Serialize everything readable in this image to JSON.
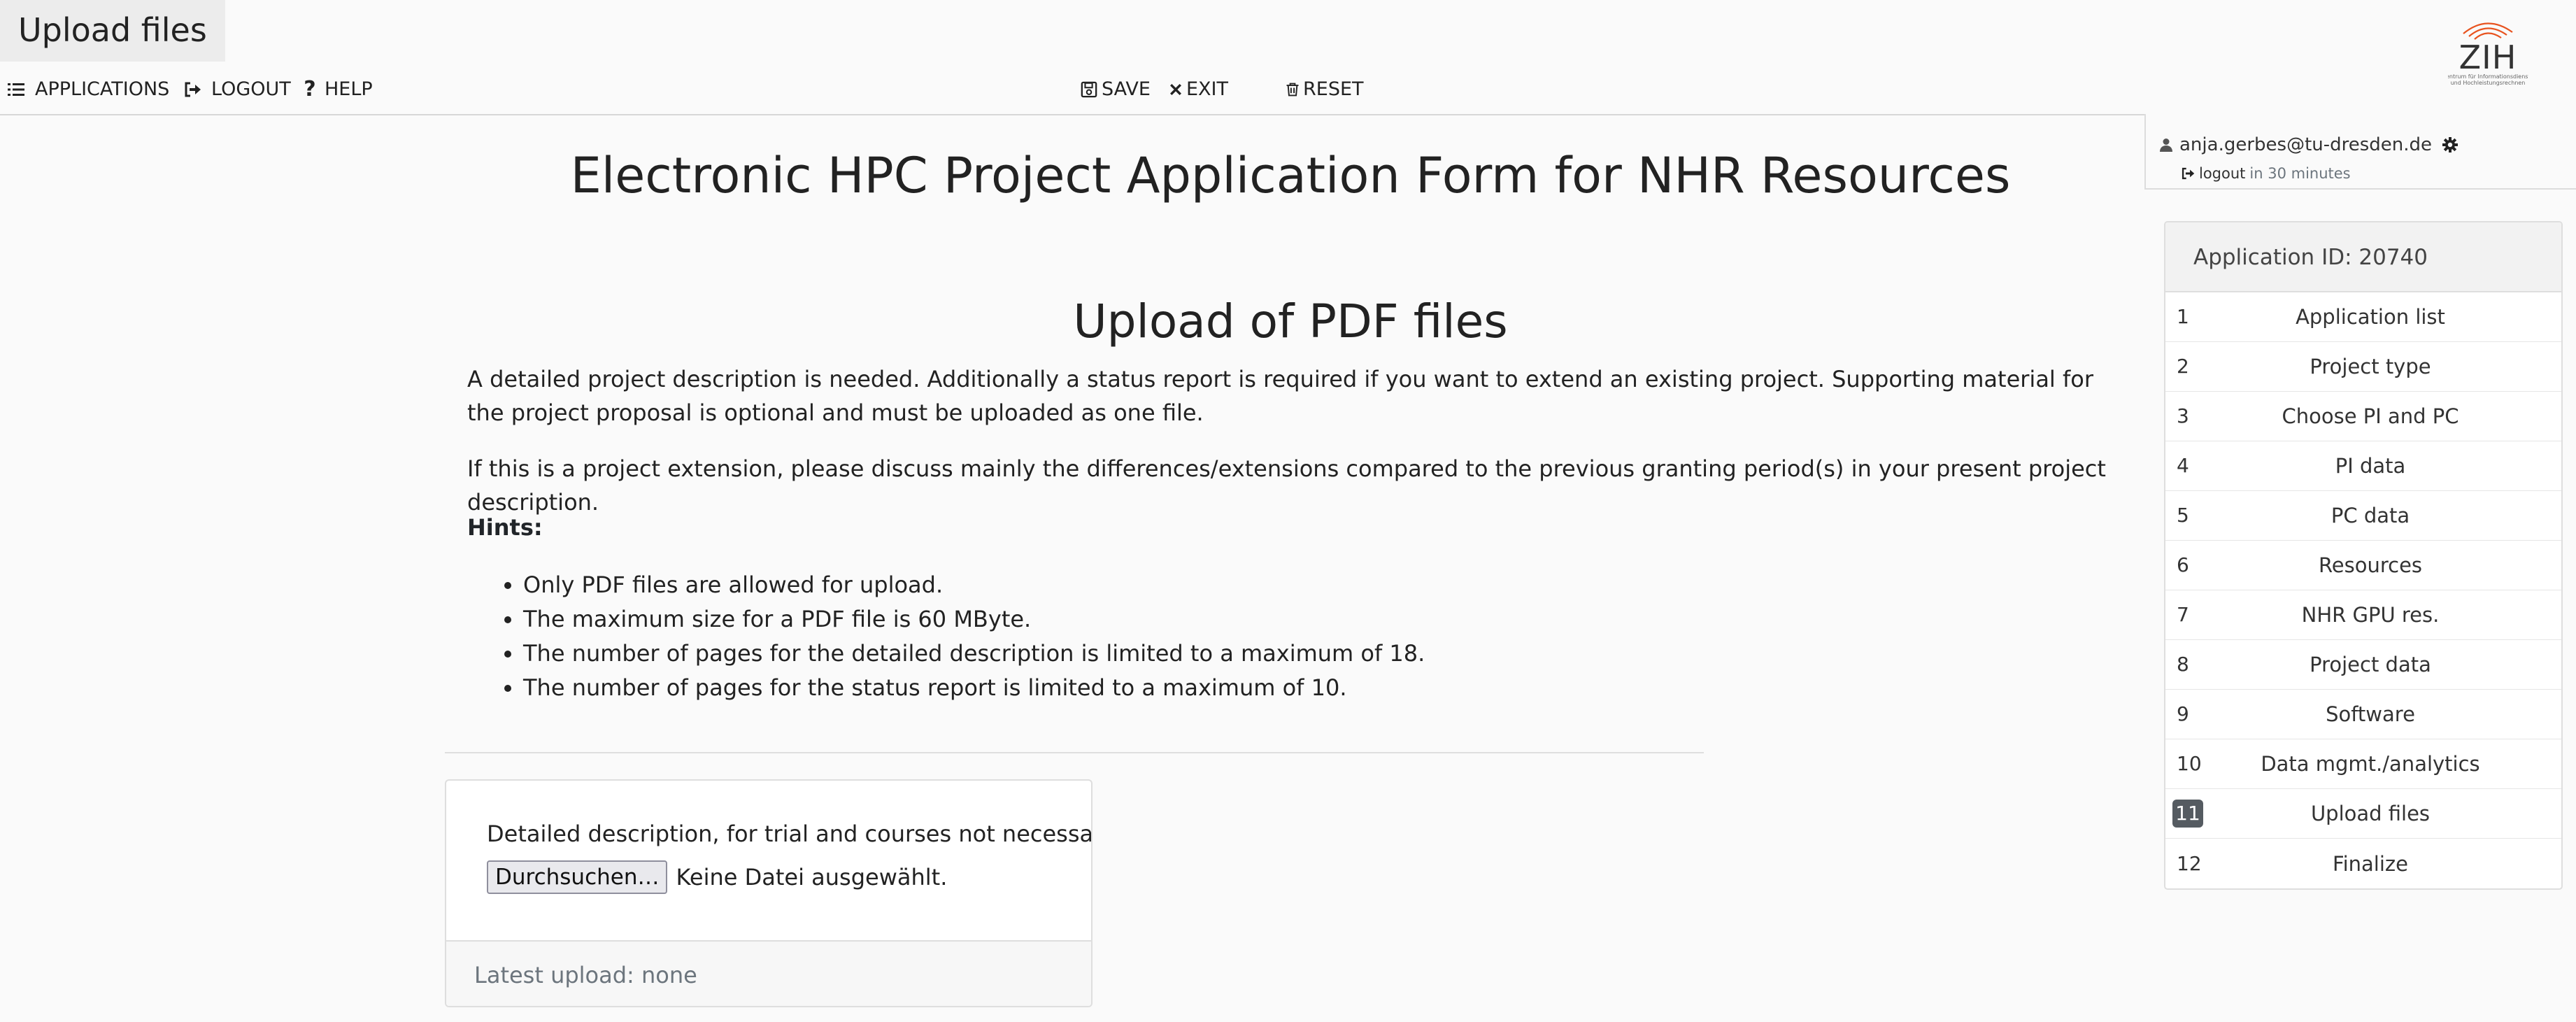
{
  "page_tab": "Upload files",
  "nav": {
    "applications": "APPLICATIONS",
    "logout": "LOGOUT",
    "help": "HELP",
    "save": "SAVE",
    "exit": "EXIT",
    "reset": "RESET"
  },
  "logo": {
    "text": "ZIH",
    "subtitle_1": "Zentrum für Informationsdienste",
    "subtitle_2": "und Hochleistungsrechnen"
  },
  "user": {
    "email": "anja.gerbes@tu-dresden.de",
    "logout_label": "logout",
    "logout_time": "in 30 minutes"
  },
  "main": {
    "form_title": "Electronic HPC Project Application Form for NHR Resources",
    "section_title": "Upload of PDF files",
    "paragraph_1": "A detailed project description is needed. Additionally a status report is required if you want to extend an existing project. Supporting material for the project proposal is optional and must be uploaded as one file.",
    "paragraph_2": "If this is a project extension, please discuss mainly the differences/extensions compared to the previous granting period(s) in your present project description.",
    "hints_label": "Hints:",
    "hints": [
      "Only PDF files are allowed for upload.",
      "The maximum size for a PDF file is 60 MByte.",
      "The number of pages for the detailed description is limited to a maximum of 18.",
      "The number of pages for the status report is limited to a maximum of 10."
    ]
  },
  "upload_card": {
    "label": "Detailed description, for trial and courses not necessary:",
    "browse_button": "Durchsuchen…",
    "no_file": "Keine Datei ausgewählt.",
    "latest_upload": "Latest upload: none"
  },
  "sidebar": {
    "app_id": "Application ID: 20740",
    "active_step": 11,
    "steps": [
      {
        "num": "1",
        "label": "Application list"
      },
      {
        "num": "2",
        "label": "Project type"
      },
      {
        "num": "3",
        "label": "Choose PI and PC"
      },
      {
        "num": "4",
        "label": "PI data"
      },
      {
        "num": "5",
        "label": "PC data"
      },
      {
        "num": "6",
        "label": "Resources"
      },
      {
        "num": "7",
        "label": "NHR GPU res."
      },
      {
        "num": "8",
        "label": "Project data"
      },
      {
        "num": "9",
        "label": "Software"
      },
      {
        "num": "10",
        "label": "Data mgmt./analytics"
      },
      {
        "num": "11",
        "label": "Upload files"
      },
      {
        "num": "12",
        "label": "Finalize"
      }
    ]
  },
  "colors": {
    "accent_logo": "#e8531f",
    "active_step_bg": "#555b61",
    "page_bg": "#fafafa"
  }
}
